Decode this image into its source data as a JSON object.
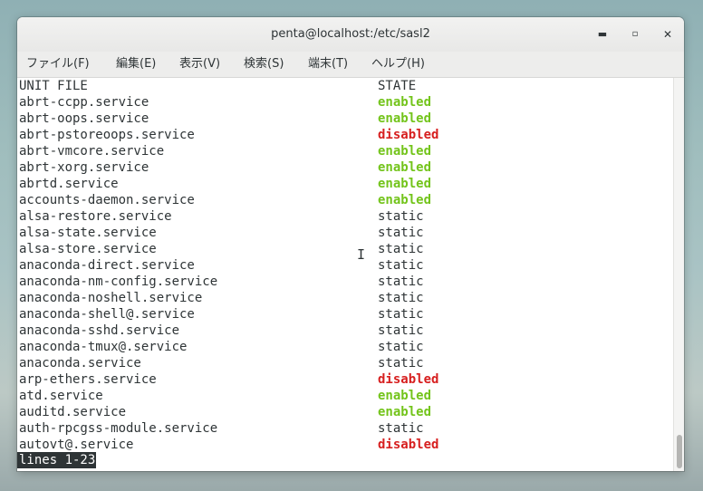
{
  "window": {
    "title": "penta@localhost:/etc/sasl2",
    "controls": {
      "minimize_icon": "minimize-icon",
      "maximize_icon": "maximize-icon",
      "close_icon": "close-icon",
      "minimize_glyph": "▬",
      "maximize_glyph": "▫",
      "close_glyph": "✕"
    }
  },
  "menu": {
    "items": [
      "ファイル(F)",
      "編集(E)",
      "表示(V)",
      "検索(S)",
      "端末(T)",
      "ヘルプ(H)"
    ]
  },
  "terminal": {
    "header": {
      "unit": "UNIT FILE",
      "state": "STATE"
    },
    "rows": [
      {
        "unit": "abrt-ccpp.service",
        "state": "enabled"
      },
      {
        "unit": "abrt-oops.service",
        "state": "enabled"
      },
      {
        "unit": "abrt-pstoreoops.service",
        "state": "disabled"
      },
      {
        "unit": "abrt-vmcore.service",
        "state": "enabled"
      },
      {
        "unit": "abrt-xorg.service",
        "state": "enabled"
      },
      {
        "unit": "abrtd.service",
        "state": "enabled"
      },
      {
        "unit": "accounts-daemon.service",
        "state": "enabled"
      },
      {
        "unit": "alsa-restore.service",
        "state": "static"
      },
      {
        "unit": "alsa-state.service",
        "state": "static"
      },
      {
        "unit": "alsa-store.service",
        "state": "static"
      },
      {
        "unit": "anaconda-direct.service",
        "state": "static"
      },
      {
        "unit": "anaconda-nm-config.service",
        "state": "static"
      },
      {
        "unit": "anaconda-noshell.service",
        "state": "static"
      },
      {
        "unit": "anaconda-shell@.service",
        "state": "static"
      },
      {
        "unit": "anaconda-sshd.service",
        "state": "static"
      },
      {
        "unit": "anaconda-tmux@.service",
        "state": "static"
      },
      {
        "unit": "anaconda.service",
        "state": "static"
      },
      {
        "unit": "arp-ethers.service",
        "state": "disabled"
      },
      {
        "unit": "atd.service",
        "state": "enabled"
      },
      {
        "unit": "auditd.service",
        "state": "enabled"
      },
      {
        "unit": "auth-rpcgss-module.service",
        "state": "static"
      },
      {
        "unit": "autovt@.service",
        "state": "disabled"
      }
    ],
    "pager_status": "lines 1-23",
    "colors": {
      "enabled": "#73c41b",
      "disabled": "#d71f1f",
      "static": "#2e3436",
      "pager_bg": "#2e3436"
    },
    "cursor_icon": "text-cursor-icon",
    "cursor_glyph": "I",
    "scrollbar_position": 1.0
  }
}
